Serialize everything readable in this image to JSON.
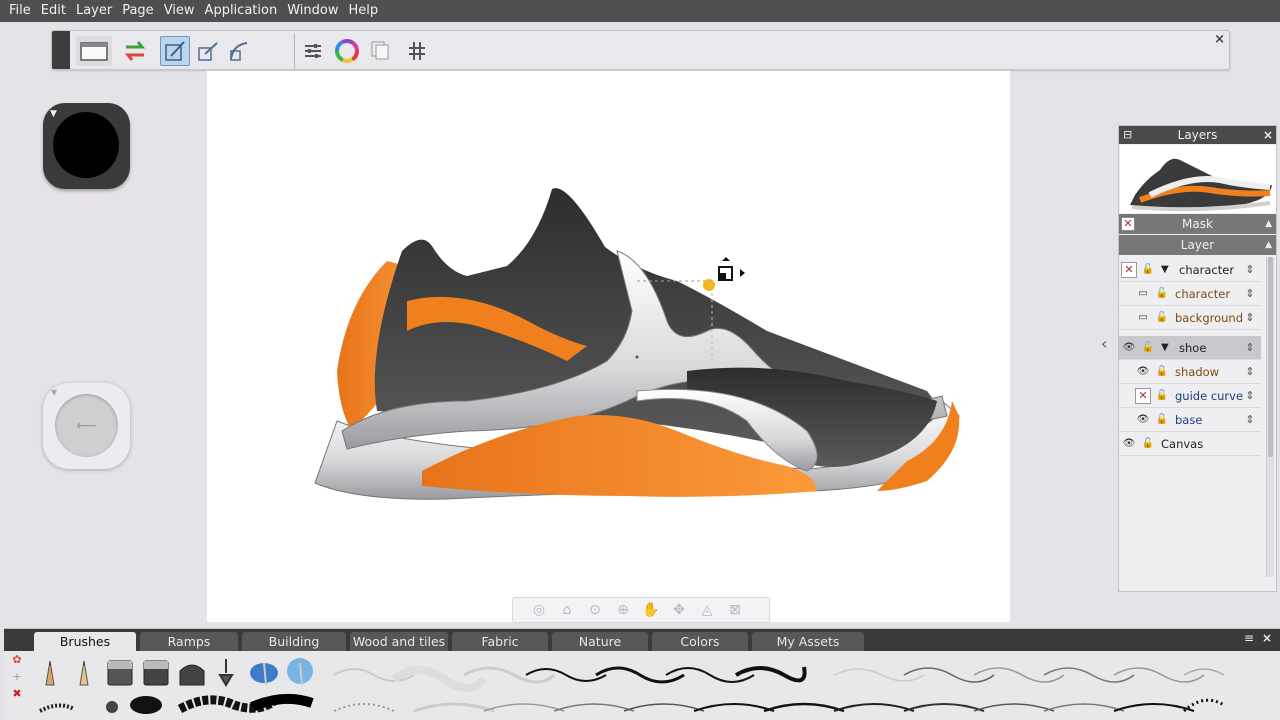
{
  "menubar": {
    "items": [
      "File",
      "Edit",
      "Layer",
      "Page",
      "View",
      "Application",
      "Window",
      "Help"
    ]
  },
  "toolbar": {
    "buttons": [
      {
        "name": "window-icon",
        "active": false
      },
      {
        "name": "swap-icon",
        "active": false
      },
      {
        "name": "stroke-scale-icon",
        "active": true
      },
      {
        "name": "stroke-scale-alt-icon",
        "active": false
      },
      {
        "name": "stroke-curve-icon",
        "active": false
      },
      {
        "name": "sliders-icon",
        "active": false
      },
      {
        "name": "color-wheel-icon",
        "active": false
      },
      {
        "name": "copy-icon",
        "active": false
      },
      {
        "name": "grid-icon",
        "active": false
      }
    ],
    "close_label": "×"
  },
  "layers": {
    "title": "Layers",
    "mask_label": "Mask",
    "layer_label": "Layer",
    "rows": [
      {
        "name": "character",
        "type": "group",
        "visible": false,
        "color": "black"
      },
      {
        "name": "character",
        "type": "layer",
        "visible": false,
        "color": "orange"
      },
      {
        "name": "background",
        "type": "layer",
        "visible": false,
        "color": "orange"
      },
      {
        "name": "shoe",
        "type": "group",
        "visible": true,
        "color": "black",
        "selected": true
      },
      {
        "name": "shadow",
        "type": "layer",
        "visible": true,
        "color": "orange"
      },
      {
        "name": "guide curves",
        "type": "layer",
        "visible": false,
        "color": "blue"
      },
      {
        "name": "base",
        "type": "layer",
        "visible": true,
        "color": "blue"
      },
      {
        "name": "Canvas",
        "type": "canvas",
        "visible": true,
        "color": "black"
      }
    ]
  },
  "brushes_panel": {
    "tabs": [
      "Brushes",
      "Ramps",
      "Building materials",
      "Wood and tiles",
      "Fabric",
      "Nature",
      "Colors",
      "My Assets"
    ],
    "active_tab": "Brushes",
    "menu_icon": "≡",
    "close_label": "×"
  },
  "navbar": {
    "icons": [
      "layers-nav-icon",
      "home-icon",
      "zoom-icon",
      "zoom-in-icon",
      "pan-hand-icon",
      "rotate-icon",
      "flip-icon",
      "fit-icon"
    ]
  },
  "colors": {
    "accent_orange": "#f07f1e",
    "shoe_dark": "#3b3b3b",
    "shoe_light": "#e9e9ec",
    "menubar": "#4f4f4f"
  }
}
